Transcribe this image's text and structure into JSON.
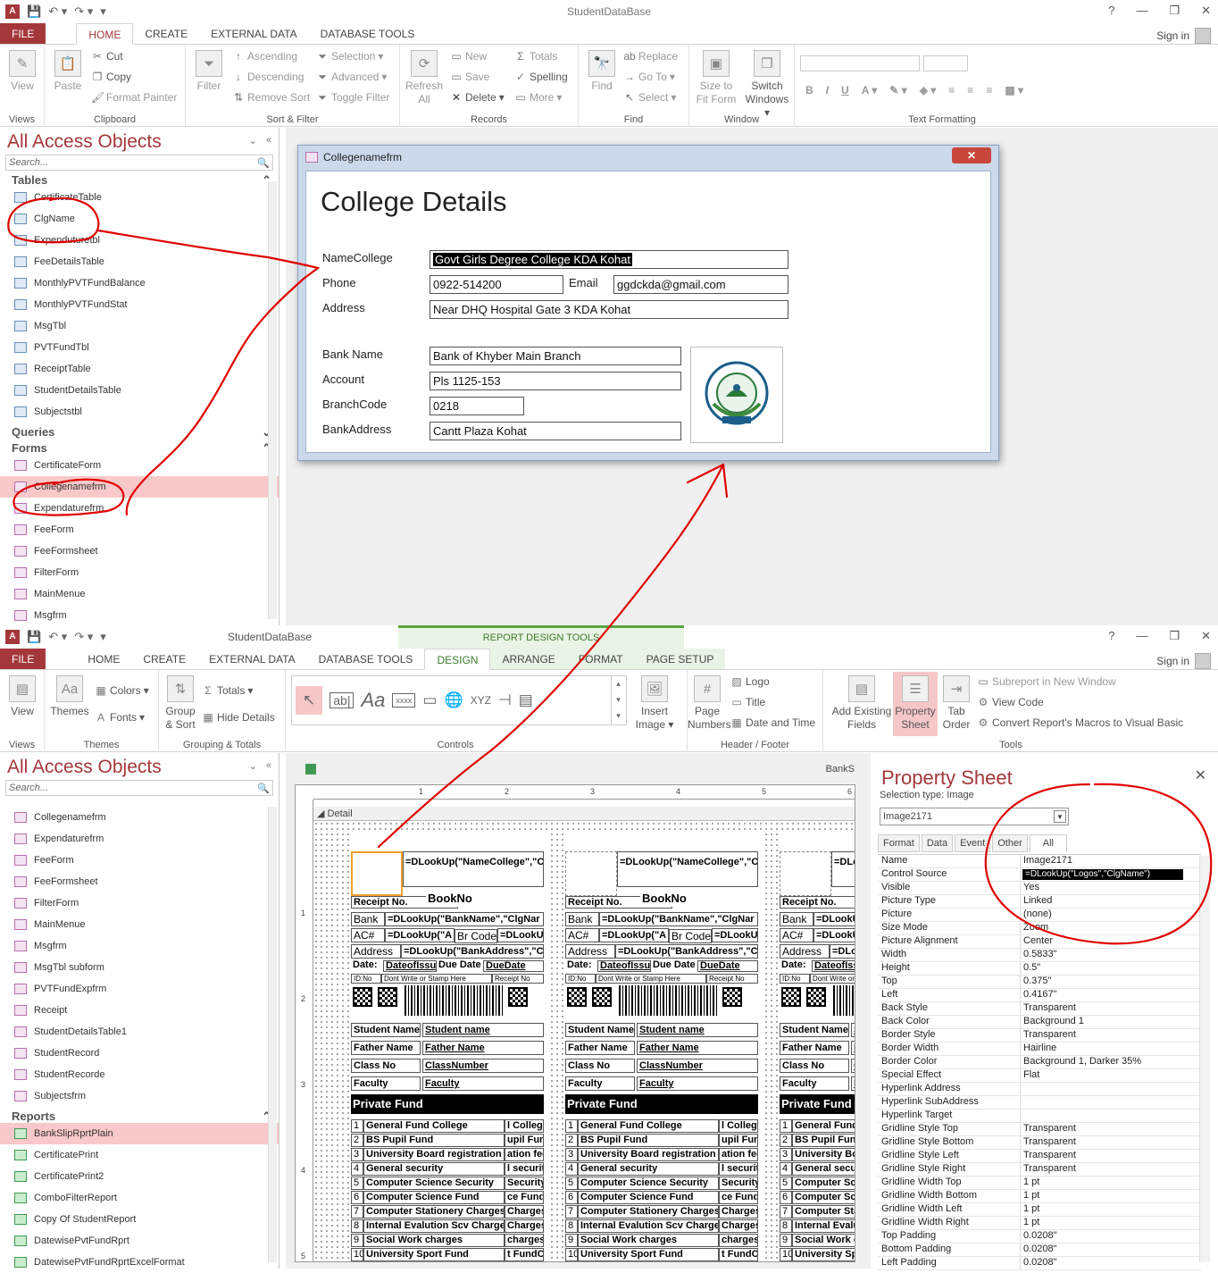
{
  "top": {
    "title": "StudentDataBase",
    "tabs": [
      "FILE",
      "HOME",
      "CREATE",
      "EXTERNAL DATA",
      "DATABASE TOOLS"
    ],
    "signin": "Sign in",
    "ribbon": {
      "views": {
        "view": "View",
        "group": "Views"
      },
      "clipboard": {
        "paste": "Paste",
        "cut": "Cut",
        "copy": "Copy",
        "painter": "Format Painter",
        "group": "Clipboard"
      },
      "sort": {
        "filter": "Filter",
        "asc": "Ascending",
        "desc": "Descending",
        "remove": "Remove Sort",
        "selection": "Selection",
        "advanced": "Advanced",
        "toggle": "Toggle Filter",
        "group": "Sort & Filter"
      },
      "records": {
        "refresh": "Refresh All",
        "new": "New",
        "save": "Save",
        "delete": "Delete",
        "totals": "Totals",
        "spelling": "Spelling",
        "more": "More",
        "group": "Records"
      },
      "find": {
        "find": "Find",
        "replace": "Replace",
        "goto": "Go To",
        "select": "Select",
        "group": "Find"
      },
      "window": {
        "size": "Size to Fit Form",
        "switch": "Switch Windows",
        "group": "Window"
      },
      "text": {
        "group": "Text Formatting"
      }
    },
    "nav": {
      "title": "All Access Objects",
      "search": "Search...",
      "tables_hdr": "Tables",
      "tables": [
        "CertificateTable",
        "ClgName",
        "Expenduturetbl",
        "FeeDetailsTable",
        "MonthlyPVTFundBalance",
        "MonthlyPVTFundStat",
        "MsgTbl",
        "PVTFundTbl",
        "ReceiptTable",
        "StudentDetailsTable",
        "Subjectstbl"
      ],
      "queries_hdr": "Queries",
      "forms_hdr": "Forms",
      "forms": [
        "CertificateForm",
        "Collegenamefrm",
        "Expendaturefrm",
        "FeeForm",
        "FeeFormsheet",
        "FilterForm",
        "MainMenue",
        "Msgfrm"
      ]
    },
    "form": {
      "window_title": "Collegenamefrm",
      "heading": "College Details",
      "close": "✕",
      "labels": {
        "name": "NameCollege",
        "phone": "Phone",
        "email": "Email",
        "address": "Address",
        "bank": "Bank Name",
        "account": "Account",
        "branch": "BranchCode",
        "bankaddr": "BankAddress"
      },
      "values": {
        "name": "Govt Girls Degree College KDA Kohat",
        "phone": "0922-514200",
        "email": "ggdckda@gmail.com",
        "address": "Near DHQ Hospital Gate 3 KDA Kohat",
        "bank": "Bank of Khyber Main Branch",
        "account": "Pls 1125-153",
        "branch": "0218",
        "bankaddr": "Cantt Plaza Kohat"
      },
      "logo_text": "GOVT GIRLS DEGREE COLLEGE K.D.A KOHAT"
    }
  },
  "bottom": {
    "title": "StudentDataBase",
    "contextual": "REPORT DESIGN TOOLS",
    "tabs": [
      "FILE",
      "HOME",
      "CREATE",
      "EXTERNAL DATA",
      "DATABASE TOOLS",
      "DESIGN",
      "ARRANGE",
      "FORMAT",
      "PAGE SETUP"
    ],
    "signin": "Sign in",
    "ribbon": {
      "view": "View",
      "views": "Views",
      "themes": "Themes",
      "colors": "Colors",
      "fonts": "Fonts",
      "themes_group": "Themes",
      "group_sort": "Group & Sort",
      "totals": "Totals",
      "hide": "Hide Details",
      "gs_group": "Grouping & Totals",
      "controls": "Controls",
      "insert_image": "Insert Image",
      "page_numbers": "Page Numbers",
      "logo": "Logo",
      "title": "Title",
      "date_time": "Date and Time",
      "hf_group": "Header / Footer",
      "add_fields": "Add Existing Fields",
      "prop_sheet": "Property Sheet",
      "tab_order": "Tab Order",
      "subreport": "Subreport in New Window",
      "view_code": "View Code",
      "convert": "Convert Report's Macros to Visual Basic",
      "tools": "Tools"
    },
    "nav": {
      "title": "All Access Objects",
      "search": "Search...",
      "forms": [
        "Collegenamefrm",
        "Expendaturefrm",
        "FeeForm",
        "FeeFormsheet",
        "FilterForm",
        "MainMenue",
        "Msgfrm",
        "MsgTbl subform",
        "PVTFundExpfrm",
        "Receipt",
        "StudentDetailsTable1",
        "StudentRecord",
        "StudentRecorde",
        "Subjectsfrm"
      ],
      "reports_hdr": "Reports",
      "reports": [
        "BankSlipRprtPlain",
        "CertificatePrint",
        "CertificatePrint2",
        "ComboFilterReport",
        "Copy Of StudentReport",
        "DatewisePvtFundRprt",
        "DatewisePvtFundRprtExcelFormat"
      ]
    },
    "report": {
      "tab_label": "BankS",
      "detail": "Detail",
      "ruler": [
        "1",
        "2",
        "3",
        "4",
        "5",
        "6"
      ],
      "vruler": [
        "1",
        "2",
        "3",
        "4",
        "5"
      ],
      "slip": {
        "namefield": "=DLookUp(\"NameCollege\",\"ClgName\")",
        "receipt": "Receipt No.",
        "bookno": "BookNo",
        "bank": "Bank",
        "bankexpr": "=DLookUp(\"BankName\",\"ClgNar",
        "ac": "AC#",
        "acexpr": "=DLookUp(\"A",
        "brcode": "Br Code",
        "brexpr": "=DLookU",
        "address": "Address",
        "addrexpr": "=DLookUp(\"BankAddress\",\"C",
        "date": "Date:",
        "dateissue": "DateofIssue",
        "duedate_lbl": "Due Date",
        "duedate": "DueDate",
        "idno": "ID:No",
        "dontwrite": "Dont Write or Stamp Here",
        "receiptno": "Receipt No",
        "student": "Student Name",
        "studentv": "Student name",
        "father": "Father Name",
        "fatherv": "Father Name",
        "class": "Class No",
        "classv": "ClassNumber",
        "faculty": "Faculty",
        "facultyv": "Faculty",
        "pf": "Private Fund",
        "rows": [
          {
            "n": "1",
            "d": "General Fund College",
            "r": "l College"
          },
          {
            "n": "2",
            "d": "BS Pupil Fund",
            "r": "upil Fund"
          },
          {
            "n": "3",
            "d": "University Board registration fee",
            "r": "ation fee"
          },
          {
            "n": "4",
            "d": "General security",
            "r": "l security"
          },
          {
            "n": "5",
            "d": "Computer Science Security",
            "r": "Security"
          },
          {
            "n": "6",
            "d": "Computer Science Fund",
            "r": "ce Fund"
          },
          {
            "n": "7",
            "d": "Computer Stationery Charges",
            "r": "Charges"
          },
          {
            "n": "8",
            "d": "Internal Evalution Scv Charges",
            "r": "Charges"
          },
          {
            "n": "9",
            "d": "Social Work charges",
            "r": "charges"
          },
          {
            "n": "10",
            "d": "University Sport Fund",
            "r": "t FundO"
          }
        ]
      }
    },
    "props": {
      "title": "Property Sheet",
      "seltype": "Selection type:  Image",
      "control": "Image2171",
      "tabs": [
        "Format",
        "Data",
        "Event",
        "Other",
        "All"
      ],
      "rows": [
        {
          "k": "Name",
          "v": "Image2171"
        },
        {
          "k": "Control Source",
          "v": "=DLookUp(\"Logos\",\"ClgName\")"
        },
        {
          "k": "Visible",
          "v": "Yes"
        },
        {
          "k": "Picture Type",
          "v": "Linked"
        },
        {
          "k": "Picture",
          "v": "(none)"
        },
        {
          "k": "Size Mode",
          "v": "Zoom"
        },
        {
          "k": "Picture Alignment",
          "v": "Center"
        },
        {
          "k": "Width",
          "v": "0.5833\""
        },
        {
          "k": "Height",
          "v": "0.5\""
        },
        {
          "k": "Top",
          "v": "0.375\""
        },
        {
          "k": "Left",
          "v": "0.4167\""
        },
        {
          "k": "Back Style",
          "v": "Transparent"
        },
        {
          "k": "Back Color",
          "v": "Background 1"
        },
        {
          "k": "Border Style",
          "v": "Transparent"
        },
        {
          "k": "Border Width",
          "v": "Hairline"
        },
        {
          "k": "Border Color",
          "v": "Background 1, Darker 35%"
        },
        {
          "k": "Special Effect",
          "v": "Flat"
        },
        {
          "k": "Hyperlink Address",
          "v": ""
        },
        {
          "k": "Hyperlink SubAddress",
          "v": ""
        },
        {
          "k": "Hyperlink Target",
          "v": ""
        },
        {
          "k": "Gridline Style Top",
          "v": "Transparent"
        },
        {
          "k": "Gridline Style Bottom",
          "v": "Transparent"
        },
        {
          "k": "Gridline Style Left",
          "v": "Transparent"
        },
        {
          "k": "Gridline Style Right",
          "v": "Transparent"
        },
        {
          "k": "Gridline Width Top",
          "v": "1 pt"
        },
        {
          "k": "Gridline Width Bottom",
          "v": "1 pt"
        },
        {
          "k": "Gridline Width Left",
          "v": "1 pt"
        },
        {
          "k": "Gridline Width Right",
          "v": "1 pt"
        },
        {
          "k": "Top Padding",
          "v": "0.0208\""
        },
        {
          "k": "Bottom Padding",
          "v": "0.0208\""
        },
        {
          "k": "Left Padding",
          "v": "0.0208\""
        }
      ]
    }
  },
  "colors": {
    "access_red": "#a4373a",
    "annotation": "#e00000",
    "selected_item": "#f9c8c9"
  }
}
